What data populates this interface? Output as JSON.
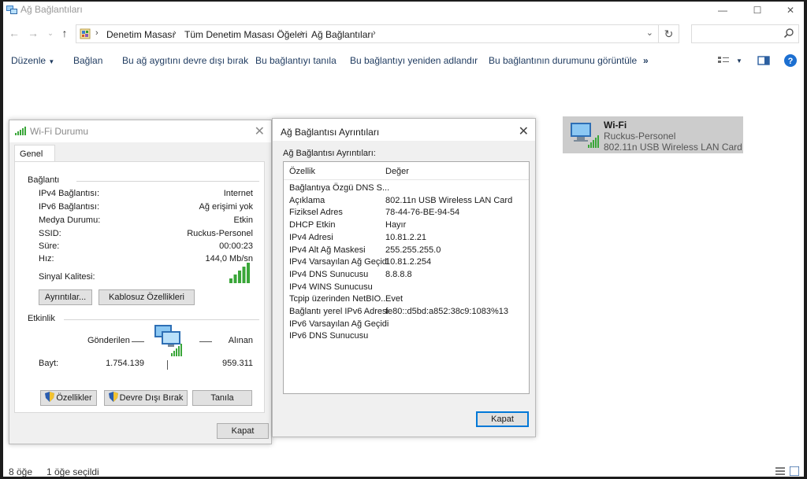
{
  "window": {
    "title": "Ağ Bağlantıları",
    "controls": {
      "minimize": "—",
      "maximize": "☐",
      "close": "✕"
    }
  },
  "address": {
    "crumbs": [
      "Denetim Masası",
      "Tüm Denetim Masası Öğeleri",
      "Ağ Bağlantıları"
    ],
    "separator": "›",
    "dropdown": "⌄",
    "refresh": "↻",
    "search_placeholder": ""
  },
  "commands": {
    "organize": "Düzenle",
    "connect": "Bağlan",
    "disable": "Bu ağ aygıtını devre dışı bırak",
    "diagnose": "Bu bağlantıyı tanıla",
    "rename": "Bu bağlantıyı yeniden adlandır",
    "view_status": "Bu bağlantının durumunu görüntüle",
    "more": "»"
  },
  "connection_item": {
    "name": "Wi-Fi",
    "network": "Ruckus-Personel",
    "adapter": "802.11n USB Wireless LAN Card"
  },
  "statusbar": {
    "item_count": "8 öğe",
    "selected": "1 öğe seçildi"
  },
  "wifi_status": {
    "title": "Wi-Fi Durumu",
    "tab": "Genel",
    "connection_group": "Bağlantı",
    "rows": [
      {
        "label": "IPv4 Bağlantısı:",
        "value": "Internet"
      },
      {
        "label": "IPv6 Bağlantısı:",
        "value": "Ağ erişimi yok"
      },
      {
        "label": "Medya Durumu:",
        "value": "Etkin"
      },
      {
        "label": "SSID:",
        "value": "Ruckus-Personel"
      },
      {
        "label": "Süre:",
        "value": "00:00:23"
      },
      {
        "label": "Hız:",
        "value": "144,0 Mb/sn"
      }
    ],
    "signal_label": "Sinyal Kalitesi:",
    "signal_bars": 5,
    "details_button": "Ayrıntılar...",
    "wireless_props_button": "Kablosuz Özellikleri",
    "activity_group": "Etkinlik",
    "sent_label": "Gönderilen",
    "received_label": "Alınan",
    "bytes_label": "Bayt:",
    "bytes_sent": "1.754.139",
    "bytes_received": "959.311",
    "properties_button": "Özellikler",
    "disable_button": "Devre Dışı Bırak",
    "diagnose_button": "Tanıla",
    "close_button": "Kapat"
  },
  "details": {
    "title": "Ağ Bağlantısı Ayrıntıları",
    "subtitle": "Ağ Bağlantısı Ayrıntıları:",
    "col_property": "Özellik",
    "col_value": "Değer",
    "rows": [
      {
        "name": "Bağlantıya Özgü DNS S...",
        "value": ""
      },
      {
        "name": "Açıklama",
        "value": "802.11n USB Wireless LAN Card"
      },
      {
        "name": "Fiziksel Adres",
        "value": "78-44-76-BE-94-54"
      },
      {
        "name": "DHCP Etkin",
        "value": "Hayır"
      },
      {
        "name": "IPv4 Adresi",
        "value": "10.81.2.21"
      },
      {
        "name": "IPv4 Alt Ağ Maskesi",
        "value": "255.255.255.0"
      },
      {
        "name": "IPv4 Varsayılan Ağ Geçidi",
        "value": "10.81.2.254"
      },
      {
        "name": "IPv4 DNS Sunucusu",
        "value": "8.8.8.8"
      },
      {
        "name": "IPv4 WINS Sunucusu",
        "value": ""
      },
      {
        "name": "Tcpip üzerinden NetBIO...",
        "value": "Evet"
      },
      {
        "name": "Bağlantı yerel IPv6 Adresi",
        "value": "fe80::d5bd:a852:38c9:1083%13"
      },
      {
        "name": "IPv6 Varsayılan Ağ Geçidi",
        "value": ""
      },
      {
        "name": "IPv6 DNS Sunucusu",
        "value": ""
      }
    ],
    "close_button": "Kapat"
  },
  "colors": {
    "accent": "#0078d7",
    "signal": "#3aa639",
    "command_text": "#1e3a5f",
    "selection": "#cccccc"
  }
}
